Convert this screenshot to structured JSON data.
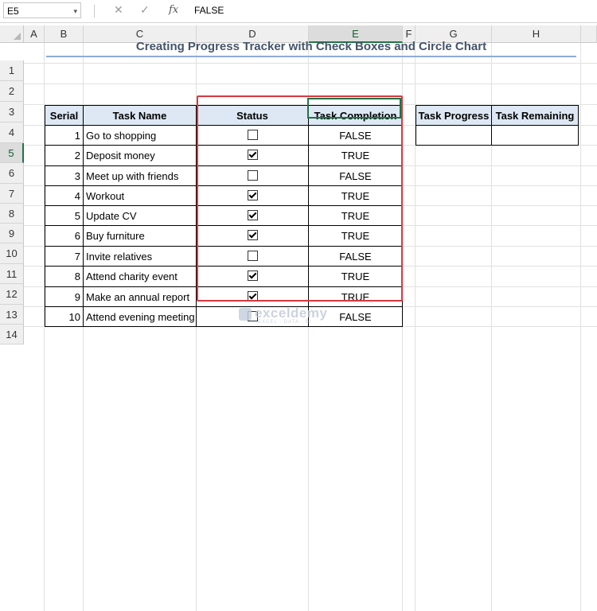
{
  "formula_bar": {
    "name_box": "E5",
    "name_box_arrow": "▾",
    "cancel_symbol": "✕",
    "enter_symbol": "✓",
    "fx_symbol": "fx",
    "formula_value": "FALSE"
  },
  "columns": [
    "A",
    "B",
    "C",
    "D",
    "E",
    "F",
    "G",
    "H"
  ],
  "rows": [
    "1",
    "2",
    "3",
    "4",
    "5",
    "6",
    "7",
    "8",
    "9",
    "10",
    "11",
    "12",
    "13",
    "14"
  ],
  "sheet": {
    "title": "Creating Progress Tracker with Check Boxes and Circle Chart",
    "task_table": {
      "headers": [
        "Serial",
        "Task Name",
        "Status",
        "Task Completion"
      ],
      "rows": [
        {
          "serial": "1",
          "task": "Go to shopping",
          "checked": false,
          "completion": "FALSE"
        },
        {
          "serial": "2",
          "task": "Deposit money",
          "checked": true,
          "completion": "TRUE"
        },
        {
          "serial": "3",
          "task": "Meet up with friends",
          "checked": false,
          "completion": "FALSE"
        },
        {
          "serial": "4",
          "task": "Workout",
          "checked": true,
          "completion": "TRUE"
        },
        {
          "serial": "5",
          "task": "Update CV",
          "checked": true,
          "completion": "TRUE"
        },
        {
          "serial": "6",
          "task": "Buy furniture",
          "checked": true,
          "completion": "TRUE"
        },
        {
          "serial": "7",
          "task": "Invite relatives",
          "checked": false,
          "completion": "FALSE"
        },
        {
          "serial": "8",
          "task": "Attend charity event",
          "checked": true,
          "completion": "TRUE"
        },
        {
          "serial": "9",
          "task": "Make an annual report",
          "checked": true,
          "completion": "TRUE"
        },
        {
          "serial": "10",
          "task": "Attend evening meeting",
          "checked": false,
          "completion": "FALSE"
        }
      ]
    },
    "progress_table": {
      "headers": [
        "Task Progress",
        "Task Remaining"
      ],
      "values": [
        "",
        ""
      ]
    }
  },
  "watermark": {
    "name": "exceldemy",
    "tagline": "EXCEL · DATA · BI"
  },
  "colors": {
    "header_fill": "#dde8f4",
    "title_text": "#44546a",
    "highlight_border": "#d9383f",
    "selection_border": "#217346"
  }
}
